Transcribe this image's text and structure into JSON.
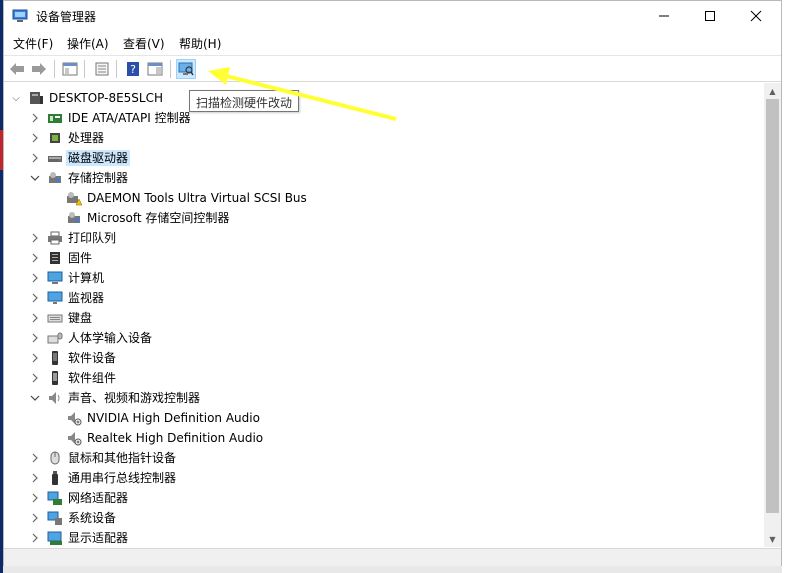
{
  "window": {
    "title": "设备管理器"
  },
  "menu": [
    "文件(F)",
    "操作(A)",
    "查看(V)",
    "帮助(H)"
  ],
  "toolbar": {
    "buttons": [
      {
        "name": "back-arrow-icon"
      },
      {
        "name": "forward-arrow-icon"
      },
      {
        "name": "show-hide-console-tree-icon"
      },
      {
        "name": "properties-icon"
      },
      {
        "name": "help-icon"
      },
      {
        "name": "action-pane-icon"
      },
      {
        "name": "scan-hardware-changes-icon"
      }
    ],
    "tooltip": "扫描检测硬件改动"
  },
  "tree": {
    "root": "DESKTOP-8E5SLCH",
    "nodes": [
      {
        "label": "IDE ATA/ATAPI 控制器",
        "level": 1,
        "state": "collapsed",
        "icon": "ide-controller-icon"
      },
      {
        "label": "处理器",
        "level": 1,
        "state": "collapsed",
        "icon": "processor-icon"
      },
      {
        "label": "磁盘驱动器",
        "level": 1,
        "state": "collapsed",
        "icon": "disk-drive-icon",
        "selected": true
      },
      {
        "label": "存储控制器",
        "level": 1,
        "state": "expanded",
        "icon": "storage-controller-icon"
      },
      {
        "label": "DAEMON Tools Ultra Virtual SCSI Bus",
        "level": 2,
        "state": "leaf",
        "icon": "storage-warning-icon"
      },
      {
        "label": "Microsoft 存储空间控制器",
        "level": 2,
        "state": "leaf",
        "icon": "storage-device-icon"
      },
      {
        "label": "打印队列",
        "level": 1,
        "state": "collapsed",
        "icon": "printer-icon"
      },
      {
        "label": "固件",
        "level": 1,
        "state": "collapsed",
        "icon": "firmware-icon"
      },
      {
        "label": "计算机",
        "level": 1,
        "state": "collapsed",
        "icon": "computer-icon"
      },
      {
        "label": "监视器",
        "level": 1,
        "state": "collapsed",
        "icon": "monitor-icon"
      },
      {
        "label": "键盘",
        "level": 1,
        "state": "collapsed",
        "icon": "keyboard-icon"
      },
      {
        "label": "人体学输入设备",
        "level": 1,
        "state": "collapsed",
        "icon": "hid-icon"
      },
      {
        "label": "软件设备",
        "level": 1,
        "state": "collapsed",
        "icon": "software-device-icon"
      },
      {
        "label": "软件组件",
        "level": 1,
        "state": "collapsed",
        "icon": "software-component-icon"
      },
      {
        "label": "声音、视频和游戏控制器",
        "level": 1,
        "state": "expanded",
        "icon": "speaker-icon"
      },
      {
        "label": "NVIDIA High Definition Audio",
        "level": 2,
        "state": "leaf",
        "icon": "audio-device-icon"
      },
      {
        "label": "Realtek High Definition Audio",
        "level": 2,
        "state": "leaf",
        "icon": "audio-device-icon"
      },
      {
        "label": "鼠标和其他指针设备",
        "level": 1,
        "state": "collapsed",
        "icon": "mouse-icon"
      },
      {
        "label": "通用串行总线控制器",
        "level": 1,
        "state": "collapsed",
        "icon": "usb-icon"
      },
      {
        "label": "网络适配器",
        "level": 1,
        "state": "collapsed",
        "icon": "network-adapter-icon"
      },
      {
        "label": "系统设备",
        "level": 1,
        "state": "collapsed",
        "icon": "system-device-icon"
      },
      {
        "label": "显示适配器",
        "level": 1,
        "state": "collapsed",
        "icon": "display-adapter-icon"
      }
    ]
  },
  "colors": {
    "selection": "#cce8ff",
    "annotation_arrow": "#ffff33"
  }
}
